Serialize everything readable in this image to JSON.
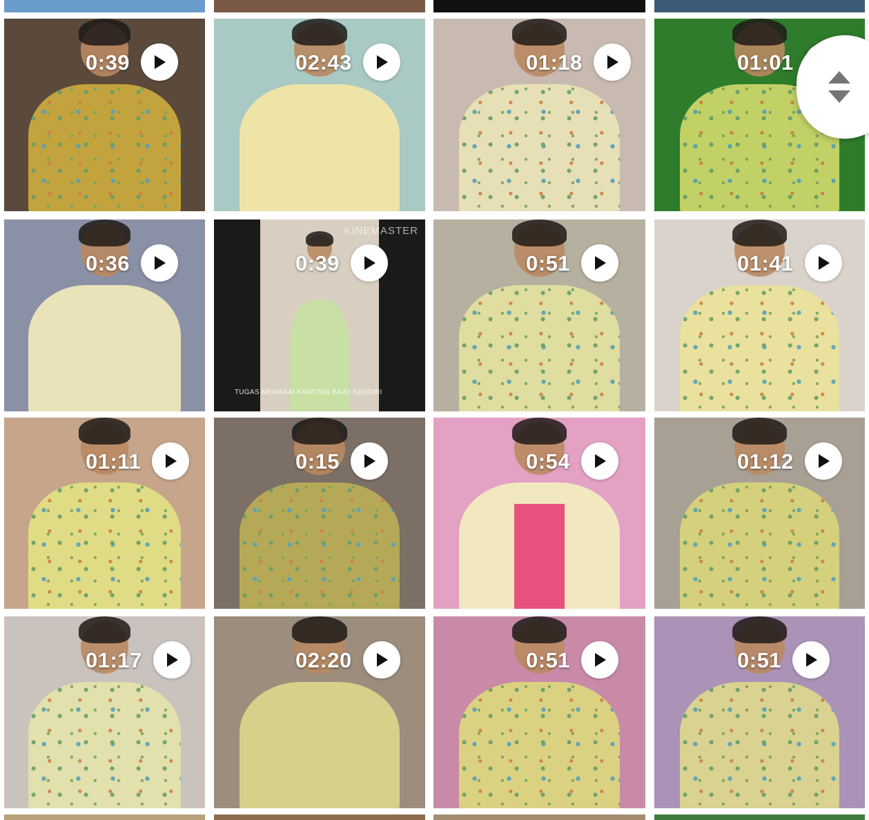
{
  "gallery": {
    "rows": [
      {
        "tiles": [
          {
            "duration": "0:39",
            "palette": {
              "bg": "#5b4a3c",
              "shirt": "#c9a83e",
              "kind": "batik-dark"
            }
          },
          {
            "duration": "02:43",
            "palette": {
              "bg": "#a9c9c4",
              "shirt": "#f1e6a6",
              "kind": "plain-yellow"
            }
          },
          {
            "duration": "01:18",
            "palette": {
              "bg": "#c8b9b1",
              "shirt": "#e9e3b8",
              "kind": "batik"
            }
          },
          {
            "duration": "01:01",
            "palette": {
              "bg": "#2f7d2c",
              "shirt": "#c9d66a",
              "kind": "batik-green"
            }
          }
        ]
      },
      {
        "tiles": [
          {
            "duration": "0:36",
            "palette": {
              "bg": "#8a90a6",
              "shirt": "#efe7b9",
              "kind": "plain-yellow"
            }
          },
          {
            "duration": "0:39",
            "palette": {
              "bg": "#1a1a1a",
              "shirt": "#c7e0a2",
              "kind": "letterbox"
            },
            "watermark": "KINEMASTER",
            "caption": "TUGAS MEMAKAI KANCING BAJU SENDIRI"
          },
          {
            "duration": "0:51",
            "palette": {
              "bg": "#b5b0a0",
              "shirt": "#e3e0a1",
              "kind": "batik"
            }
          },
          {
            "duration": "01:41",
            "palette": {
              "bg": "#d9d3cc",
              "shirt": "#eae29b",
              "kind": "batik"
            }
          }
        ]
      },
      {
        "tiles": [
          {
            "duration": "01:11",
            "palette": {
              "bg": "#c6a58a",
              "shirt": "#e2df86",
              "kind": "batik-open"
            }
          },
          {
            "duration": "0:15",
            "palette": {
              "bg": "#7c6f66",
              "shirt": "#b9ad57",
              "kind": "batik-dark"
            }
          },
          {
            "duration": "0:54",
            "palette": {
              "bg": "#e3a1c4",
              "shirt": "#f1ecc1",
              "kind": "pink"
            }
          },
          {
            "duration": "01:12",
            "palette": {
              "bg": "#a8a094",
              "shirt": "#d8d37a",
              "kind": "batik"
            }
          }
        ]
      },
      {
        "tiles": [
          {
            "duration": "01:17",
            "palette": {
              "bg": "#c9c2bd",
              "shirt": "#e4e2ac",
              "kind": "batik"
            }
          },
          {
            "duration": "02:20",
            "palette": {
              "bg": "#9c8d7c",
              "shirt": "#d9d48c",
              "kind": "plain-yellow"
            }
          },
          {
            "duration": "0:51",
            "palette": {
              "bg": "#c98aa8",
              "shirt": "#ddd67f",
              "kind": "batik"
            }
          },
          {
            "duration": "0:51",
            "palette": {
              "bg": "#aa93b6",
              "shirt": "#dcd690",
              "kind": "batik"
            }
          }
        ]
      }
    ]
  },
  "fast_scroll": {
    "icon": "up-down-arrows-icon"
  },
  "colors": {
    "overlay_text": "#ffffff",
    "play_button": "#ffffff",
    "play_triangle": "#111111",
    "background": "#ffffff"
  }
}
